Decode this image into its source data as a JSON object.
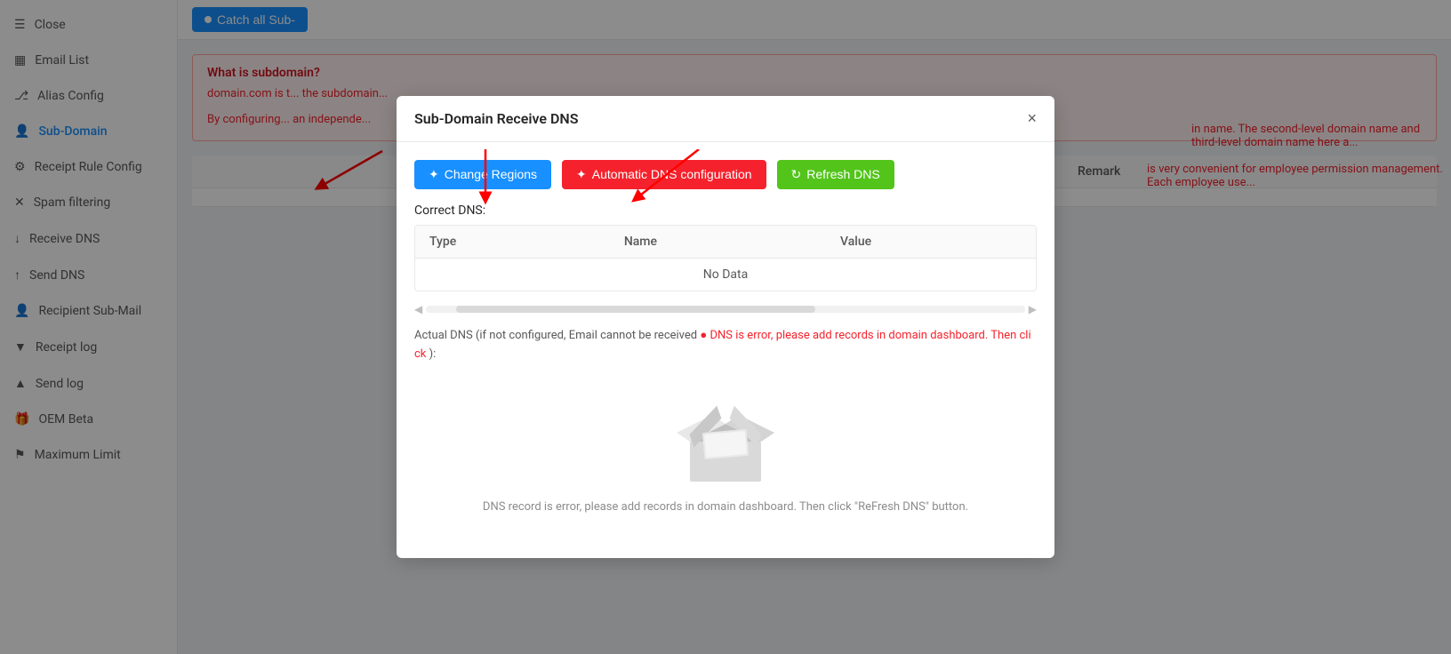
{
  "sidebar": {
    "items": [
      {
        "id": "close",
        "label": "Close",
        "icon": "☰",
        "active": false
      },
      {
        "id": "email-list",
        "label": "Email List",
        "icon": "📊",
        "active": false
      },
      {
        "id": "alias-config",
        "label": "Alias Config",
        "icon": "🔗",
        "active": false
      },
      {
        "id": "sub-domain",
        "label": "Sub-Domain",
        "icon": "👤",
        "active": true
      },
      {
        "id": "receipt-rule-config",
        "label": "Receipt Rule Config",
        "icon": "⚙",
        "active": false
      },
      {
        "id": "spam-filtering",
        "label": "Spam filtering",
        "icon": "✕",
        "active": false
      },
      {
        "id": "receive-dns",
        "label": "Receive DNS",
        "icon": "↓",
        "active": false
      },
      {
        "id": "send-dns",
        "label": "Send DNS",
        "icon": "↑",
        "active": false
      },
      {
        "id": "recipient-sub-mail",
        "label": "Recipient Sub-Mail",
        "icon": "👤",
        "active": false
      },
      {
        "id": "receipt-log",
        "label": "Receipt log",
        "icon": "▼",
        "active": false
      },
      {
        "id": "send-log",
        "label": "Send log",
        "icon": "▲",
        "active": false
      },
      {
        "id": "oem-beta",
        "label": "OEM Beta",
        "icon": "🎁",
        "active": false
      },
      {
        "id": "maximum-limit",
        "label": "Maximum Limit",
        "icon": "⚑",
        "active": false
      }
    ]
  },
  "topbar": {
    "catch_all_label": "Catch all Sub-"
  },
  "content": {
    "info_title": "What is subdo...",
    "info_text1": "domain.com is t...",
    "info_text2": "By configuring...",
    "table_headers": [
      "",
      "Remark"
    ],
    "remark_col": "Remark"
  },
  "dialog": {
    "title": "Sub-Domain Receive DNS",
    "close_label": "×",
    "buttons": {
      "change_regions": "Change Regions",
      "auto_dns": "Automatic DNS configuration",
      "refresh_dns": "Refresh DNS"
    },
    "correct_dns_label": "Correct DNS:",
    "table": {
      "columns": [
        "Type",
        "Name",
        "Value"
      ],
      "no_data": "No Data"
    },
    "actual_dns_prefix": "Actual DNS (if not configured, Email cannot be received ",
    "actual_dns_error": "DNS is error, please add records in domain dashboard. Then cli\nck",
    "actual_dns_suffix": "):",
    "empty_state_text": "DNS record is error, please add records in domain dashboard. Then click \"ReFresh DNS\" button."
  }
}
